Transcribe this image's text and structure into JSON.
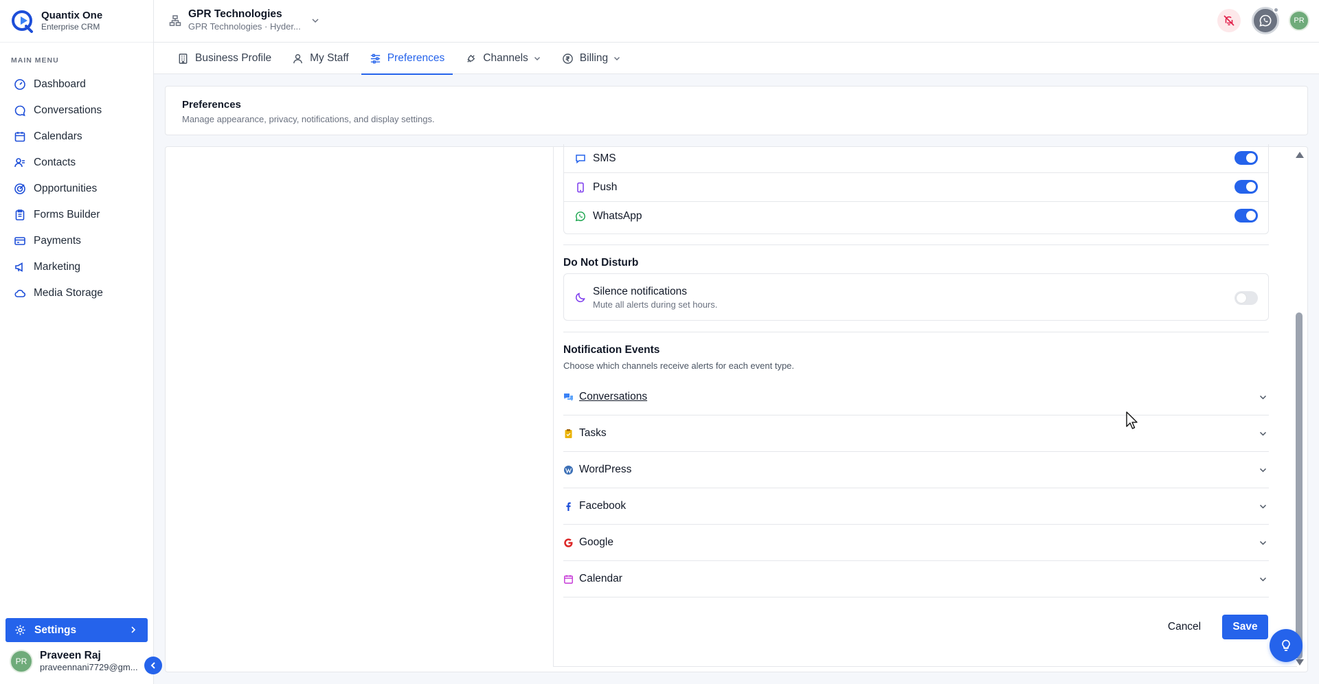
{
  "brand": {
    "name": "Quantix One",
    "subtitle": "Enterprise CRM"
  },
  "sidebar": {
    "menu_title": "MAIN MENU",
    "items": [
      {
        "label": "Dashboard",
        "icon": "dashboard-icon"
      },
      {
        "label": "Conversations",
        "icon": "chat-icon"
      },
      {
        "label": "Calendars",
        "icon": "calendar-icon"
      },
      {
        "label": "Contacts",
        "icon": "contacts-icon"
      },
      {
        "label": "Opportunities",
        "icon": "target-icon"
      },
      {
        "label": "Forms Builder",
        "icon": "clipboard-icon"
      },
      {
        "label": "Payments",
        "icon": "card-icon"
      },
      {
        "label": "Marketing",
        "icon": "megaphone-icon"
      },
      {
        "label": "Media Storage",
        "icon": "cloud-icon"
      }
    ],
    "settings_label": "Settings",
    "user": {
      "initials": "PR",
      "name": "Praveen Raj",
      "email": "praveennani7729@gm..."
    }
  },
  "topbar": {
    "org_name": "GPR Technologies",
    "org_sub": "GPR Technologies · Hyder...",
    "avatar_initials": "PR"
  },
  "tabs": [
    {
      "label": "Business Profile",
      "icon": "building-icon"
    },
    {
      "label": "My Staff",
      "icon": "user-icon"
    },
    {
      "label": "Preferences",
      "icon": "sliders-icon",
      "active": true
    },
    {
      "label": "Channels",
      "icon": "plug-icon",
      "dropdown": true
    },
    {
      "label": "Billing",
      "icon": "rupee-icon",
      "dropdown": true
    }
  ],
  "header": {
    "title": "Preferences",
    "subtitle": "Manage appearance, privacy, notifications, and display settings."
  },
  "channels": [
    {
      "label": "SMS",
      "enabled": true
    },
    {
      "label": "Push",
      "enabled": true
    },
    {
      "label": "WhatsApp",
      "enabled": true
    }
  ],
  "dnd": {
    "section_title": "Do Not Disturb",
    "title": "Silence notifications",
    "subtitle": "Mute all alerts during set hours.",
    "enabled": false
  },
  "events": {
    "title": "Notification Events",
    "subtitle": "Choose which channels receive alerts for each event type.",
    "items": [
      {
        "label": "Conversations"
      },
      {
        "label": "Tasks"
      },
      {
        "label": "WordPress"
      },
      {
        "label": "Facebook"
      },
      {
        "label": "Google"
      },
      {
        "label": "Calendar"
      }
    ]
  },
  "actions": {
    "cancel": "Cancel",
    "save": "Save"
  },
  "colors": {
    "primary": "#2563eb",
    "whatsapp": "#16a34a",
    "google": "#dc2626",
    "tasks": "#eab308"
  }
}
